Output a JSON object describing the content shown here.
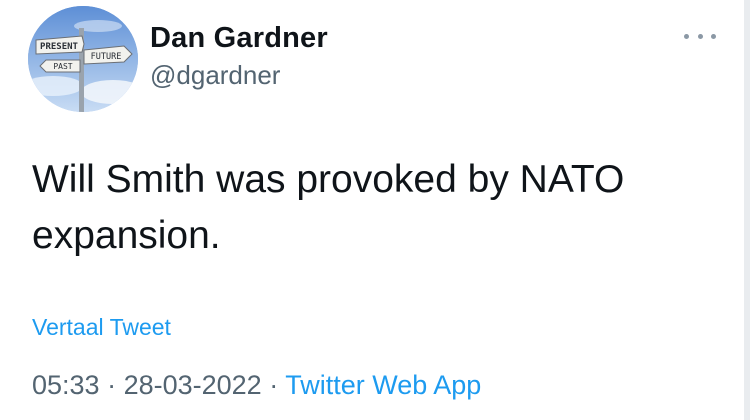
{
  "author": {
    "display_name": "Dan Gardner",
    "handle": "@dgardner",
    "avatar_sign": {
      "present": "PRESENT",
      "future": "FUTURE",
      "past": "PAST"
    }
  },
  "tweet": {
    "text": "Will Smith was provoked by NATO expansion."
  },
  "actions": {
    "more_icon": "more-horizontal-icon",
    "translate_label": "Vertaal Tweet"
  },
  "meta": {
    "time": "05:33",
    "separator1": " · ",
    "date": "28-03-2022",
    "separator2": " · ",
    "source": "Twitter Web App"
  },
  "colors": {
    "text": "#0f1419",
    "secondary": "#536471",
    "link": "#1d9bf0"
  }
}
